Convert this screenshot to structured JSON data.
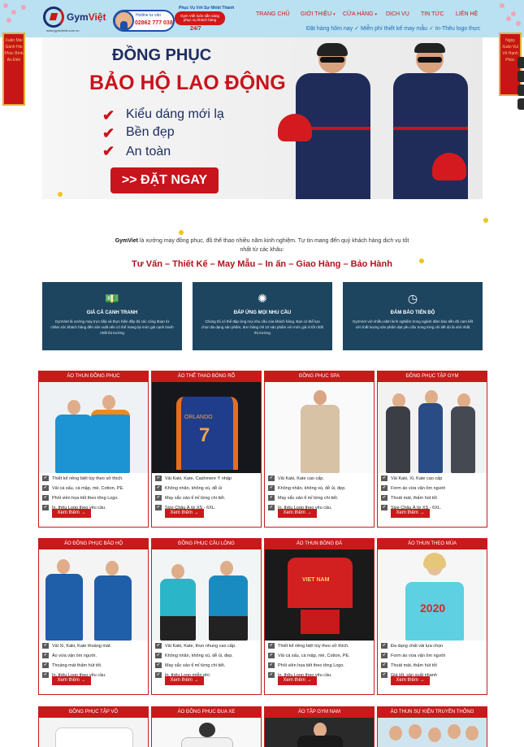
{
  "header": {
    "logo_name_part1": "Gym",
    "logo_name_part2": "Việt",
    "logo_sub": "www.gymvietst.com.vn",
    "hotline_label": "Hotline tư vấn",
    "hotline_number": "02862 777 038",
    "service_top": "Phục Vụ Với Sự Nhiệt Thành",
    "service_text": "Gym Việt luôn sẵn sàng phục vụ khách hàng",
    "service_hours": "24/7",
    "nav": [
      "TRANG CHỦ",
      "GIỚI THIỆU",
      "CỬA HÀNG",
      "DỊCH VỤ",
      "TIN TỨC",
      "LIÊN HỆ"
    ],
    "ticker": "Đặt hàng hôm nay ✓ Miễn phí thiết kế may mẫu ✓ In-Thêu logo thực"
  },
  "banner": {
    "title1": "ĐỒNG PHỤC",
    "title2": "BẢO HỘ LAO ĐỘNG",
    "features": [
      "Kiểu dáng mới lạ",
      "Bền đẹp",
      "An toàn"
    ],
    "cta": ">> ĐẶT NGAY"
  },
  "intro": {
    "brand": "GymViet",
    "text": "là xưởng may đồng phục, đồ thể thao nhiều năm kinh nghiệm. Tự tin mang đến quý khách hàng dịch vụ tốt nhất từ các khâu:",
    "tagline": "Tư Vấn – Thiết Kế – May Mẫu – In ấn – Giao Hàng – Bảo Hành"
  },
  "features": [
    {
      "icon": "money-icon",
      "title": "GIÁ CẢ CẠNH TRANH",
      "desc": "GymViet là xưởng may trực tiếp và thực hiện đầy đủ các công đoạn từ chăm sóc khách hàng đến sản xuất nên có thể mang lại mức giá cạnh tranh nhất thị trường"
    },
    {
      "icon": "loading-icon",
      "title": "ĐÁP ỨNG MỌI NHU CẦU",
      "desc": "Chúng tôi có thể đáp ứng mọi nhu cầu của khách hàng. Bạn có thể lựa chọn đa dạng sản phẩm, đơn hàng chỉ 10 sản phẩm với mức giá sỉ tốt nhất thị trường"
    },
    {
      "icon": "clock-icon",
      "title": "ĐẢM BẢO TIẾN ĐỘ",
      "desc": "GymViet với nhiều năm kinh nghiệm trong ngành đảm bảo tiến độ cam kết với chất lượng sản phẩm đạt yêu cầu trong từng chi tiết dù là nhỏ nhất"
    }
  ],
  "more_label": "Xem thêm →",
  "products": [
    {
      "title": "ÁO THUN ĐỒNG PHỤC",
      "items": [
        "Thiết kế riêng biệt tùy theo sở thích.",
        "Vải cá sấu, cá mập, mè, Cotton, PE.",
        "Phối viền họa tiết theo tông Logo.",
        "In, thêu Logo theo yêu cầu."
      ]
    },
    {
      "title": "ÁO THỂ THAO BÓNG RỔ",
      "items": [
        "Vải Kaki, Kate, Cashmere Ý nhập",
        "Không nhăn, không xù, dễ ủi",
        "May sắc sảo tỉ mỉ từng chi tiết.",
        "Size Châu Á từ XS - 6XL."
      ]
    },
    {
      "title": "ĐỒNG PHỤC SPA",
      "items": [
        "Vải Kaki, Kate cao cấp.",
        "Không nhăn, không xù, dễ ủi, đẹp.",
        "May sắc sảo tỉ mỉ từng chi tiết.",
        "In, thêu Logo theo yêu cầu."
      ]
    },
    {
      "title": "ĐỒNG PHỤC TẬP GYM",
      "items": [
        "Vải Kaki, Xi, Kate cao cấp",
        "Form áo vừa vặn ôm người",
        "Thoát mát, thấm hút tốt",
        "Size Châu Á từ XS - 6XL."
      ]
    },
    {
      "title": "ÁO ĐỒNG PHỤC BẢO HỘ",
      "items": [
        "Vải Xi, Kaki, Kate thoáng mát.",
        "Áo vừa vặn ôm người.",
        "Thoáng mát thấm hút tốt.",
        "In, thêu Logo theo yêu cầu."
      ]
    },
    {
      "title": "ĐỒNG PHỤC CẦU LÔNG",
      "items": [
        "Vải Kaki, Kate, thun nhung cao cấp.",
        "Không nhăn, không xù, dễ ủi, đẹp.",
        "May sắc sảo tỉ mỉ từng chi tiết.",
        "In, thêu Logo miễn phí."
      ]
    },
    {
      "title": "ÁO THUN BÓNG ĐÁ",
      "items": [
        "Thiết kế riêng biệt tùy theo sở thích.",
        "Vải cá sấu, cá mập, mè, Cotton, PE.",
        "Phối viền họa tiết theo tông Logo.",
        "In, thêu Logo theo yêu cầu."
      ]
    },
    {
      "title": "ÁO THUN THEO MÙA",
      "items": [
        "Đa dạng chất vải lựa chọn",
        "Form áo vừa vặn ôm người",
        "Thoát mát, thấm hút tốt",
        "Giá tốt, sản xuất nhanh"
      ]
    },
    {
      "title": "ĐỒNG PHỤC TẬP VÕ",
      "items": []
    },
    {
      "title": "ÁO ĐỒNG PHỤC ĐUA XE",
      "items": []
    },
    {
      "title": "ÁO TẬP GYM NAM",
      "items": []
    },
    {
      "title": "ÁO THUN SỰ KIỆN TRUYỀN THỐNG",
      "items": []
    }
  ],
  "image_text": {
    "basketball_name": "ORLANDO",
    "basketball_number": "7",
    "football_team": "VIET NAM",
    "season_shirt": "2020"
  },
  "lanterns": {
    "left": "Xuân Mai Gánh Hái Phúc Bình An Đến",
    "right": "Ngày Xuân Vui Vẻ Hạnh Phúc"
  },
  "colors": {
    "brand_red": "#c81a1a",
    "navy": "#1d4560",
    "header_bg": "#b9e1f1"
  }
}
